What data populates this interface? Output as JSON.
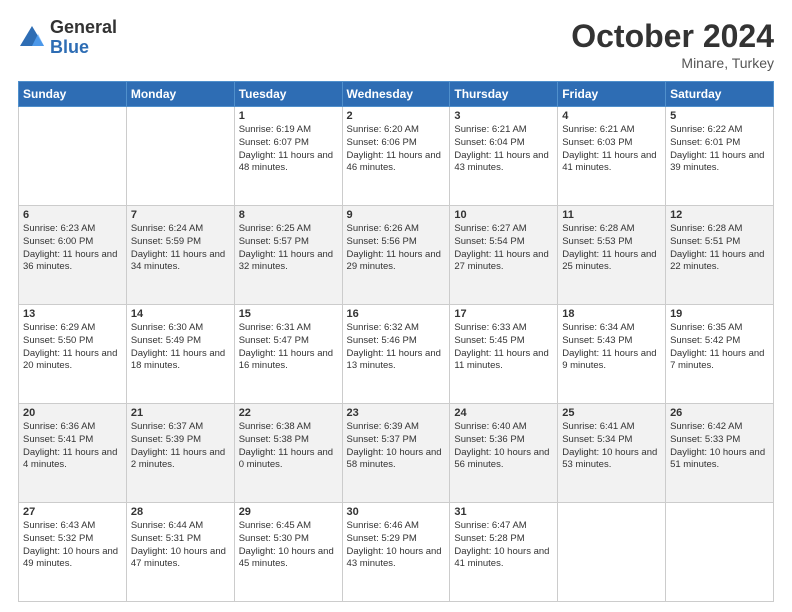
{
  "logo": {
    "general": "General",
    "blue": "Blue"
  },
  "header": {
    "month": "October 2024",
    "location": "Minare, Turkey"
  },
  "weekdays": [
    "Sunday",
    "Monday",
    "Tuesday",
    "Wednesday",
    "Thursday",
    "Friday",
    "Saturday"
  ],
  "weeks": [
    [
      {
        "day": "",
        "content": ""
      },
      {
        "day": "",
        "content": ""
      },
      {
        "day": "1",
        "content": "Sunrise: 6:19 AM\nSunset: 6:07 PM\nDaylight: 11 hours and 48 minutes."
      },
      {
        "day": "2",
        "content": "Sunrise: 6:20 AM\nSunset: 6:06 PM\nDaylight: 11 hours and 46 minutes."
      },
      {
        "day": "3",
        "content": "Sunrise: 6:21 AM\nSunset: 6:04 PM\nDaylight: 11 hours and 43 minutes."
      },
      {
        "day": "4",
        "content": "Sunrise: 6:21 AM\nSunset: 6:03 PM\nDaylight: 11 hours and 41 minutes."
      },
      {
        "day": "5",
        "content": "Sunrise: 6:22 AM\nSunset: 6:01 PM\nDaylight: 11 hours and 39 minutes."
      }
    ],
    [
      {
        "day": "6",
        "content": "Sunrise: 6:23 AM\nSunset: 6:00 PM\nDaylight: 11 hours and 36 minutes."
      },
      {
        "day": "7",
        "content": "Sunrise: 6:24 AM\nSunset: 5:59 PM\nDaylight: 11 hours and 34 minutes."
      },
      {
        "day": "8",
        "content": "Sunrise: 6:25 AM\nSunset: 5:57 PM\nDaylight: 11 hours and 32 minutes."
      },
      {
        "day": "9",
        "content": "Sunrise: 6:26 AM\nSunset: 5:56 PM\nDaylight: 11 hours and 29 minutes."
      },
      {
        "day": "10",
        "content": "Sunrise: 6:27 AM\nSunset: 5:54 PM\nDaylight: 11 hours and 27 minutes."
      },
      {
        "day": "11",
        "content": "Sunrise: 6:28 AM\nSunset: 5:53 PM\nDaylight: 11 hours and 25 minutes."
      },
      {
        "day": "12",
        "content": "Sunrise: 6:28 AM\nSunset: 5:51 PM\nDaylight: 11 hours and 22 minutes."
      }
    ],
    [
      {
        "day": "13",
        "content": "Sunrise: 6:29 AM\nSunset: 5:50 PM\nDaylight: 11 hours and 20 minutes."
      },
      {
        "day": "14",
        "content": "Sunrise: 6:30 AM\nSunset: 5:49 PM\nDaylight: 11 hours and 18 minutes."
      },
      {
        "day": "15",
        "content": "Sunrise: 6:31 AM\nSunset: 5:47 PM\nDaylight: 11 hours and 16 minutes."
      },
      {
        "day": "16",
        "content": "Sunrise: 6:32 AM\nSunset: 5:46 PM\nDaylight: 11 hours and 13 minutes."
      },
      {
        "day": "17",
        "content": "Sunrise: 6:33 AM\nSunset: 5:45 PM\nDaylight: 11 hours and 11 minutes."
      },
      {
        "day": "18",
        "content": "Sunrise: 6:34 AM\nSunset: 5:43 PM\nDaylight: 11 hours and 9 minutes."
      },
      {
        "day": "19",
        "content": "Sunrise: 6:35 AM\nSunset: 5:42 PM\nDaylight: 11 hours and 7 minutes."
      }
    ],
    [
      {
        "day": "20",
        "content": "Sunrise: 6:36 AM\nSunset: 5:41 PM\nDaylight: 11 hours and 4 minutes."
      },
      {
        "day": "21",
        "content": "Sunrise: 6:37 AM\nSunset: 5:39 PM\nDaylight: 11 hours and 2 minutes."
      },
      {
        "day": "22",
        "content": "Sunrise: 6:38 AM\nSunset: 5:38 PM\nDaylight: 11 hours and 0 minutes."
      },
      {
        "day": "23",
        "content": "Sunrise: 6:39 AM\nSunset: 5:37 PM\nDaylight: 10 hours and 58 minutes."
      },
      {
        "day": "24",
        "content": "Sunrise: 6:40 AM\nSunset: 5:36 PM\nDaylight: 10 hours and 56 minutes."
      },
      {
        "day": "25",
        "content": "Sunrise: 6:41 AM\nSunset: 5:34 PM\nDaylight: 10 hours and 53 minutes."
      },
      {
        "day": "26",
        "content": "Sunrise: 6:42 AM\nSunset: 5:33 PM\nDaylight: 10 hours and 51 minutes."
      }
    ],
    [
      {
        "day": "27",
        "content": "Sunrise: 6:43 AM\nSunset: 5:32 PM\nDaylight: 10 hours and 49 minutes."
      },
      {
        "day": "28",
        "content": "Sunrise: 6:44 AM\nSunset: 5:31 PM\nDaylight: 10 hours and 47 minutes."
      },
      {
        "day": "29",
        "content": "Sunrise: 6:45 AM\nSunset: 5:30 PM\nDaylight: 10 hours and 45 minutes."
      },
      {
        "day": "30",
        "content": "Sunrise: 6:46 AM\nSunset: 5:29 PM\nDaylight: 10 hours and 43 minutes."
      },
      {
        "day": "31",
        "content": "Sunrise: 6:47 AM\nSunset: 5:28 PM\nDaylight: 10 hours and 41 minutes."
      },
      {
        "day": "",
        "content": ""
      },
      {
        "day": "",
        "content": ""
      }
    ]
  ]
}
